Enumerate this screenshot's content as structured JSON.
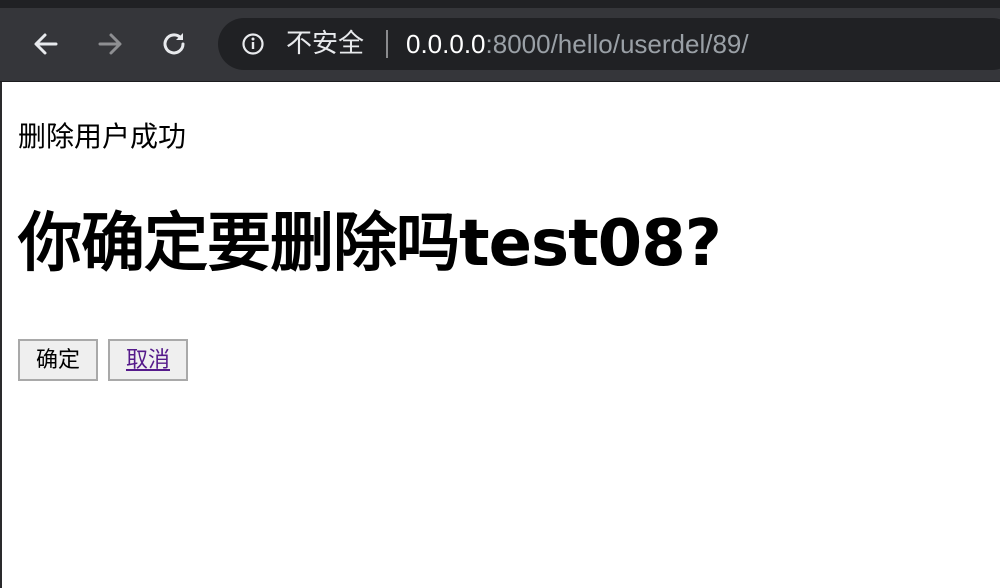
{
  "browser": {
    "security_label": "不安全",
    "url_host": "0.0.0.0",
    "url_path": ":8000/hello/userdel/89/"
  },
  "page": {
    "status_message": "删除用户成功",
    "confirm_prompt": "你确定要删除吗test08?",
    "confirm_button_label": "确定",
    "cancel_link_label": "取消"
  },
  "icons": [
    "back-arrow-icon",
    "forward-arrow-icon",
    "reload-icon",
    "info-icon"
  ]
}
